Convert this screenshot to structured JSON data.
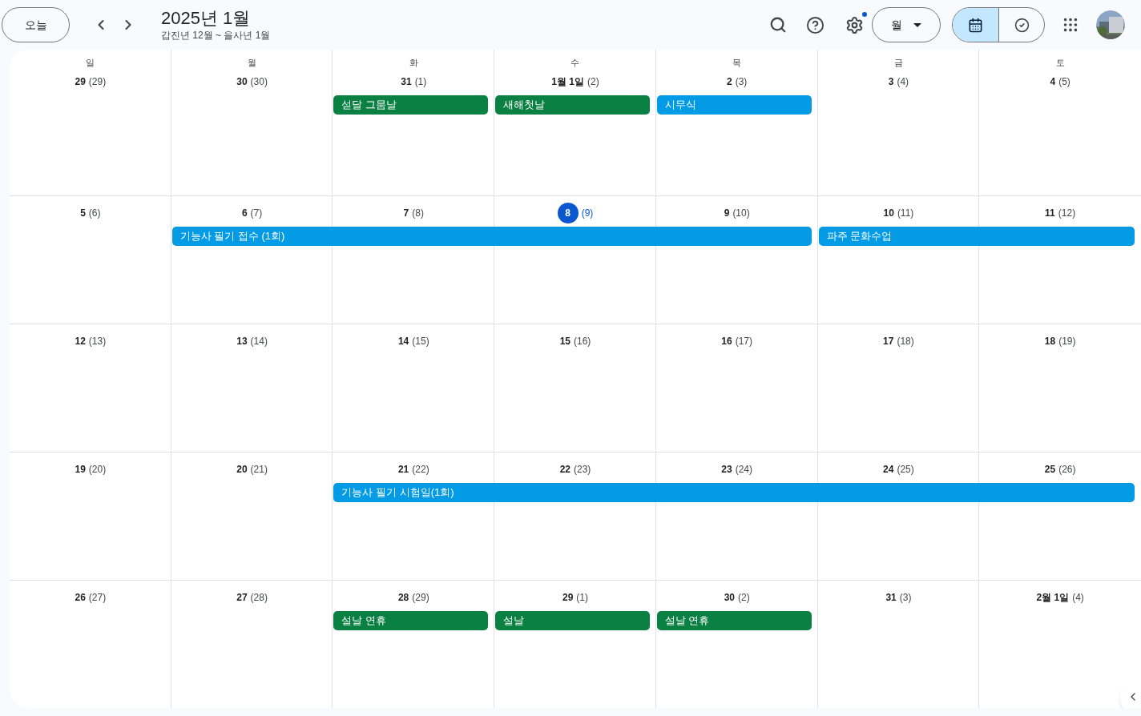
{
  "toolbar": {
    "today_button": "오늘",
    "title": "2025년 1월",
    "subtitle": "갑진년 12월 ~ 을사년 1월",
    "settings_badge": true,
    "view_dropdown": "월",
    "modes": [
      {
        "kind": "calendar",
        "selected": true
      },
      {
        "kind": "tasks",
        "selected": false
      }
    ]
  },
  "weekdays": [
    "일",
    "월",
    "화",
    "수",
    "목",
    "금",
    "토"
  ],
  "weeks": [
    {
      "days": [
        {
          "date": "29",
          "lunar": "(29)",
          "today": false
        },
        {
          "date": "30",
          "lunar": "(30)",
          "today": false
        },
        {
          "date": "31",
          "lunar": "(1)",
          "today": false,
          "events": [
            {
              "kind": "start",
              "title": "섣달 그뭄날",
              "color": "#0b8043"
            }
          ]
        },
        {
          "date": "1월 1일",
          "lunar": "(2)",
          "today": false,
          "events": [
            {
              "kind": "start",
              "title": "새해첫날",
              "color": "#0b8043"
            }
          ]
        },
        {
          "date": "2",
          "lunar": "(3)",
          "today": false,
          "events": [
            {
              "kind": "start",
              "title": "시무식",
              "color": "#039be5"
            }
          ]
        },
        {
          "date": "3",
          "lunar": "(4)",
          "today": false
        },
        {
          "date": "4",
          "lunar": "(5)",
          "today": false
        }
      ]
    },
    {
      "days": [
        {
          "date": "5",
          "lunar": "(6)",
          "today": false
        },
        {
          "date": "6",
          "lunar": "(7)",
          "today": false,
          "events": [
            {
              "kind": "start",
              "title": "기능사 필기 접수 (1회)",
              "color": "#039be5"
            }
          ]
        },
        {
          "date": "7",
          "lunar": "(8)",
          "today": false,
          "events": [
            {
              "kind": "continue"
            }
          ]
        },
        {
          "date": "8",
          "lunar": "(9)",
          "today": true,
          "events": [
            {
              "kind": "continue"
            }
          ]
        },
        {
          "date": "9",
          "lunar": "(10)",
          "today": false,
          "events": [
            {
              "kind": "continue"
            }
          ]
        },
        {
          "date": "10",
          "lunar": "(11)",
          "today": false,
          "events": [
            {
              "kind": "start",
              "title": "파주 문화수업",
              "color": "#039be5"
            }
          ]
        },
        {
          "date": "11",
          "lunar": "(12)",
          "today": false,
          "events": [
            {
              "kind": "continue"
            }
          ]
        }
      ]
    },
    {
      "days": [
        {
          "date": "12",
          "lunar": "(13)",
          "today": false
        },
        {
          "date": "13",
          "lunar": "(14)",
          "today": false
        },
        {
          "date": "14",
          "lunar": "(15)",
          "today": false
        },
        {
          "date": "15",
          "lunar": "(16)",
          "today": false
        },
        {
          "date": "16",
          "lunar": "(17)",
          "today": false
        },
        {
          "date": "17",
          "lunar": "(18)",
          "today": false
        },
        {
          "date": "18",
          "lunar": "(19)",
          "today": false
        }
      ]
    },
    {
      "days": [
        {
          "date": "19",
          "lunar": "(20)",
          "today": false
        },
        {
          "date": "20",
          "lunar": "(21)",
          "today": false
        },
        {
          "date": "21",
          "lunar": "(22)",
          "today": false,
          "events": [
            {
              "kind": "start",
              "title": "기능사 필기 시험일(1회)",
              "color": "#039be5"
            }
          ]
        },
        {
          "date": "22",
          "lunar": "(23)",
          "today": false,
          "events": [
            {
              "kind": "continue"
            }
          ]
        },
        {
          "date": "23",
          "lunar": "(24)",
          "today": false,
          "events": [
            {
              "kind": "continue"
            }
          ]
        },
        {
          "date": "24",
          "lunar": "(25)",
          "today": false,
          "events": [
            {
              "kind": "continue"
            }
          ]
        },
        {
          "date": "25",
          "lunar": "(26)",
          "today": false,
          "events": [
            {
              "kind": "continue"
            }
          ]
        }
      ]
    },
    {
      "days": [
        {
          "date": "26",
          "lunar": "(27)",
          "today": false
        },
        {
          "date": "27",
          "lunar": "(28)",
          "today": false
        },
        {
          "date": "28",
          "lunar": "(29)",
          "today": false,
          "events": [
            {
              "kind": "start",
              "title": "설날 연휴",
              "color": "#0b8043"
            }
          ]
        },
        {
          "date": "29",
          "lunar": "(1)",
          "today": false,
          "events": [
            {
              "kind": "start",
              "title": "설날",
              "color": "#0b8043"
            }
          ]
        },
        {
          "date": "30",
          "lunar": "(2)",
          "today": false,
          "events": [
            {
              "kind": "start",
              "title": "설날 연휴",
              "color": "#0b8043"
            }
          ]
        },
        {
          "date": "31",
          "lunar": "(3)",
          "today": false
        },
        {
          "date": "2월 1일",
          "lunar": "(4)",
          "today": false
        }
      ]
    }
  ]
}
